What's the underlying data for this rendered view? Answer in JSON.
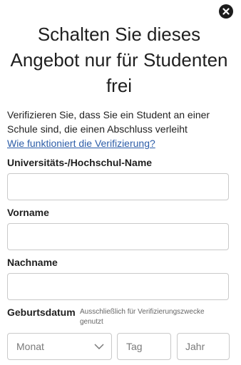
{
  "dialog": {
    "title_line1": "Schalten Sie dieses",
    "title_line2": "Angebot nur für Studenten",
    "title_line3": "frei",
    "description_line1": "Verifizieren Sie, dass Sie ein Student an einer",
    "description_line2": "Schule sind, die einen Abschluss verleiht",
    "help_link": "Wie funktioniert die Verifizierung?",
    "close_icon": "close-icon"
  },
  "form": {
    "university": {
      "label": "Universitäts-/Hochschul-Name",
      "value": "",
      "placeholder": ""
    },
    "first_name": {
      "label": "Vorname",
      "value": "",
      "placeholder": ""
    },
    "last_name": {
      "label": "Nachname",
      "value": "",
      "placeholder": ""
    },
    "birthdate": {
      "label": "Geburtsdatum",
      "hint_line1": "Ausschließlich für Verifizierungszwecke",
      "hint_line2": "genutzt",
      "month_placeholder": "Monat",
      "day_placeholder": "Tag",
      "year_placeholder": "Jahr"
    }
  },
  "colors": {
    "link": "#2c5da8",
    "close_button": "#1c1c1c",
    "input_border": "#c9c9c9"
  }
}
